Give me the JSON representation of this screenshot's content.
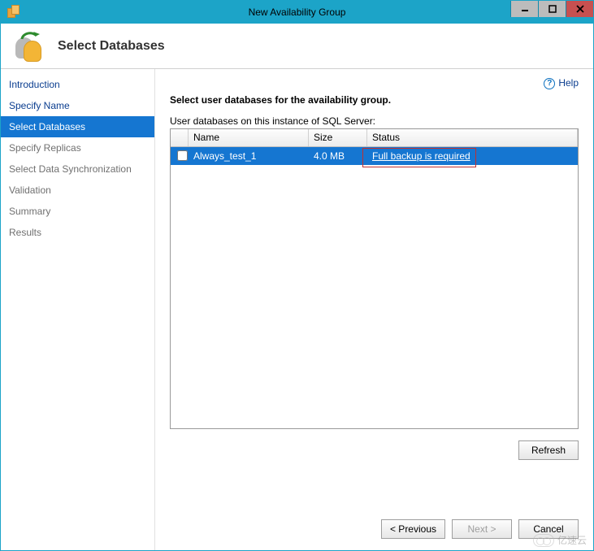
{
  "window": {
    "title": "New Availability Group"
  },
  "header": {
    "title": "Select Databases"
  },
  "help": {
    "label": "Help"
  },
  "sidebar": {
    "items": [
      {
        "label": "Introduction",
        "state": "done"
      },
      {
        "label": "Specify Name",
        "state": "done"
      },
      {
        "label": "Select Databases",
        "state": "selected"
      },
      {
        "label": "Specify Replicas",
        "state": "future"
      },
      {
        "label": "Select Data Synchronization",
        "state": "future"
      },
      {
        "label": "Validation",
        "state": "future"
      },
      {
        "label": "Summary",
        "state": "future"
      },
      {
        "label": "Results",
        "state": "future"
      }
    ]
  },
  "main": {
    "heading": "Select user databases for the availability group.",
    "subheading": "User databases on this instance of SQL Server:",
    "columns": {
      "name": "Name",
      "size": "Size",
      "status": "Status"
    },
    "rows": [
      {
        "checked": false,
        "name": "Always_test_1",
        "size": "4.0 MB",
        "status": "Full backup is required"
      }
    ],
    "refresh_label": "Refresh"
  },
  "footer": {
    "previous": "< Previous",
    "next": "Next >",
    "cancel": "Cancel"
  },
  "watermark": {
    "text": "亿速云"
  }
}
